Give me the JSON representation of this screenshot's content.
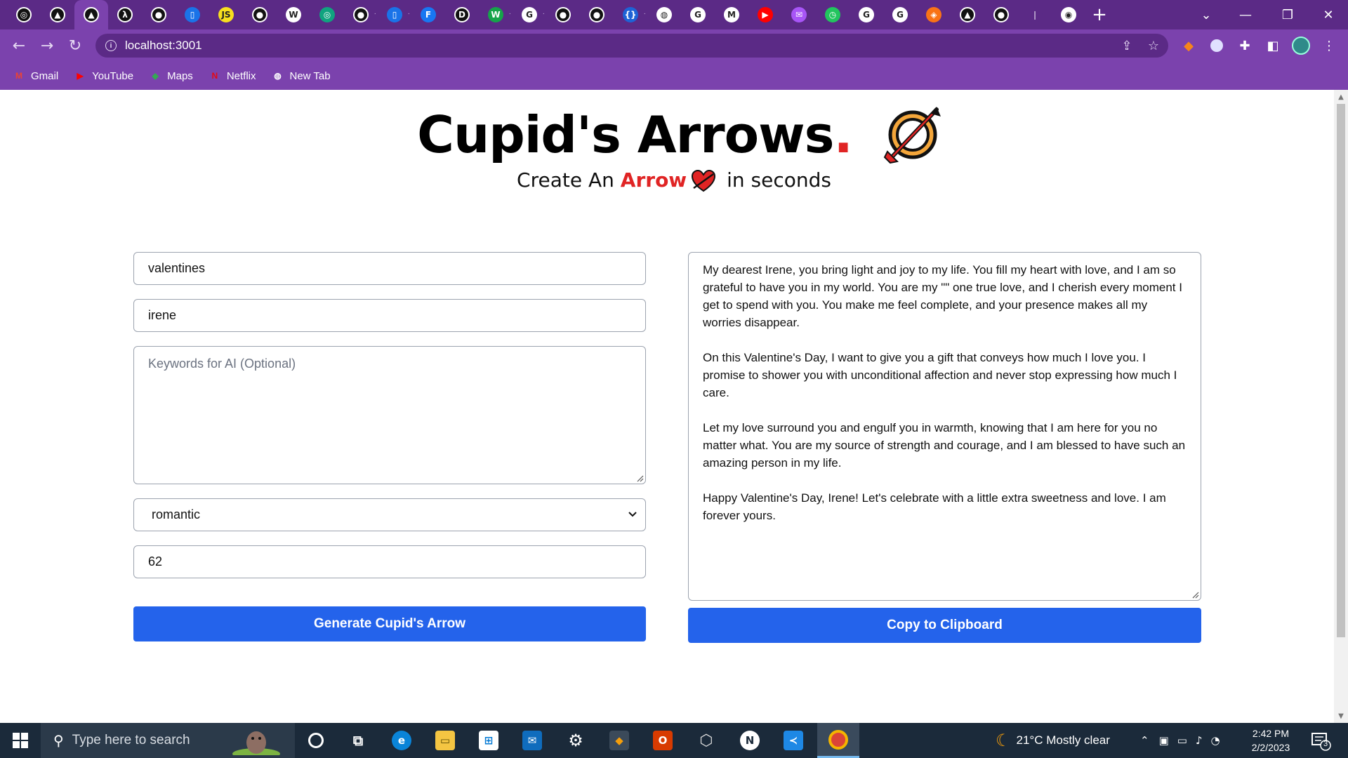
{
  "browser": {
    "tabs": [
      {
        "name": "chatgpt",
        "glyph": "◎",
        "color": "#111111",
        "dots": false
      },
      {
        "name": "vercel",
        "glyph": "▲",
        "color": "#111111",
        "dots": false
      },
      {
        "name": "vercel-active",
        "glyph": "▲",
        "color": "#111111",
        "dots": false
      },
      {
        "name": "lambda",
        "glyph": "λ",
        "color": "#111111",
        "dots": false
      },
      {
        "name": "github",
        "glyph": "●",
        "color": "#111111",
        "dots": false
      },
      {
        "name": "mouse",
        "glyph": "▯",
        "color": "#1a73e8",
        "dots": false
      },
      {
        "name": "js",
        "glyph": "JS",
        "color": "#f7df1e",
        "dots": false
      },
      {
        "name": "github",
        "glyph": "●",
        "color": "#111111",
        "dots": false
      },
      {
        "name": "wikipedia",
        "glyph": "W",
        "color": "#ffffff",
        "dots": false
      },
      {
        "name": "openai",
        "glyph": "◎",
        "color": "#10a37f",
        "dots": false
      },
      {
        "name": "github",
        "glyph": "●",
        "color": "#111111",
        "dots": true
      },
      {
        "name": "mouse",
        "glyph": "▯",
        "color": "#1a73e8",
        "dots": true
      },
      {
        "name": "framer",
        "glyph": "F",
        "color": "#1877f2",
        "dots": false
      },
      {
        "name": "d",
        "glyph": "D",
        "color": "#111111",
        "dots": false
      },
      {
        "name": "w",
        "glyph": "W",
        "color": "#16a34a",
        "dots": true
      },
      {
        "name": "google",
        "glyph": "G",
        "color": "#ffffff",
        "dots": true
      },
      {
        "name": "github",
        "glyph": "●",
        "color": "#111111",
        "dots": false
      },
      {
        "name": "github",
        "glyph": "●",
        "color": "#111111",
        "dots": false
      },
      {
        "name": "code",
        "glyph": "{}",
        "color": "#1e63d6",
        "dots": true
      },
      {
        "name": "globe",
        "glyph": "◍",
        "color": "#ffffff",
        "dots": false
      },
      {
        "name": "google",
        "glyph": "G",
        "color": "#ffffff",
        "dots": false
      },
      {
        "name": "gmail",
        "glyph": "M",
        "color": "#ffffff",
        "dots": false
      },
      {
        "name": "youtube",
        "glyph": "▶",
        "color": "#ff0000",
        "dots": false
      },
      {
        "name": "messenger",
        "glyph": "✉",
        "color": "#a855f7",
        "dots": false
      },
      {
        "name": "clock",
        "glyph": "◷",
        "color": "#22c55e",
        "dots": false
      },
      {
        "name": "grammarly",
        "glyph": "G",
        "color": "#ffffff",
        "dots": false
      },
      {
        "name": "google",
        "glyph": "G",
        "color": "#ffffff",
        "dots": false
      },
      {
        "name": "extension",
        "glyph": "◈",
        "color": "#f97316",
        "dots": false
      },
      {
        "name": "vercel",
        "glyph": "▲",
        "color": "#111111",
        "dots": false
      },
      {
        "name": "github",
        "glyph": "●",
        "color": "#111111",
        "dots": false
      },
      {
        "name": "feather",
        "glyph": "❘",
        "color": "#5b2a86",
        "dots": false
      },
      {
        "name": "chrome",
        "glyph": "◉",
        "color": "#ffffff",
        "dots": false
      }
    ],
    "url": "localhost:3001",
    "bookmarks": [
      {
        "label": "Gmail",
        "glyph": "M",
        "color": "#ea4335"
      },
      {
        "label": "YouTube",
        "glyph": "▶",
        "color": "#ff0000"
      },
      {
        "label": "Maps",
        "glyph": "◆",
        "color": "#34a853"
      },
      {
        "label": "Netflix",
        "glyph": "N",
        "color": "#e50914"
      },
      {
        "label": "New Tab",
        "glyph": "◍",
        "color": "#ffffff"
      }
    ]
  },
  "page": {
    "title": "Cupid's Arrows",
    "title_dot": ".",
    "subtitle_pre": "Create An ",
    "subtitle_accent": "Arrow",
    "subtitle_post": " in seconds",
    "form": {
      "occasion_value": "valentines",
      "name_value": "irene",
      "keywords_placeholder": "Keywords for AI (Optional)",
      "tone_value": "romantic",
      "length_value": "62",
      "generate_label": "Generate Cupid's Arrow"
    },
    "output": {
      "paragraphs": [
        "My dearest Irene, you bring light and joy to my life. You fill my heart with love, and I am so grateful to have you in my world. You are my \"\" one true love, and I cherish every moment I get to spend with you. You make me feel complete, and your presence makes all my worries disappear.",
        "On this Valentine's Day, I want to give you a gift that conveys how much I love you. I promise to shower you with unconditional affection and never stop expressing how much I care.",
        "Let my love surround you and engulf you in warmth, knowing that I am here for you no matter what. You are my source of strength and courage, and I am blessed to have such an amazing person in my life.",
        "Happy Valentine's Day, Irene! Let's celebrate with a little extra sweetness and love. I am forever yours."
      ],
      "copy_label": "Copy to Clipboard"
    }
  },
  "taskbar": {
    "search_placeholder": "Type here to search",
    "weather": "21°C  Mostly clear",
    "time": "2:42 PM",
    "date": "2/2/2023",
    "notifications": "3"
  }
}
